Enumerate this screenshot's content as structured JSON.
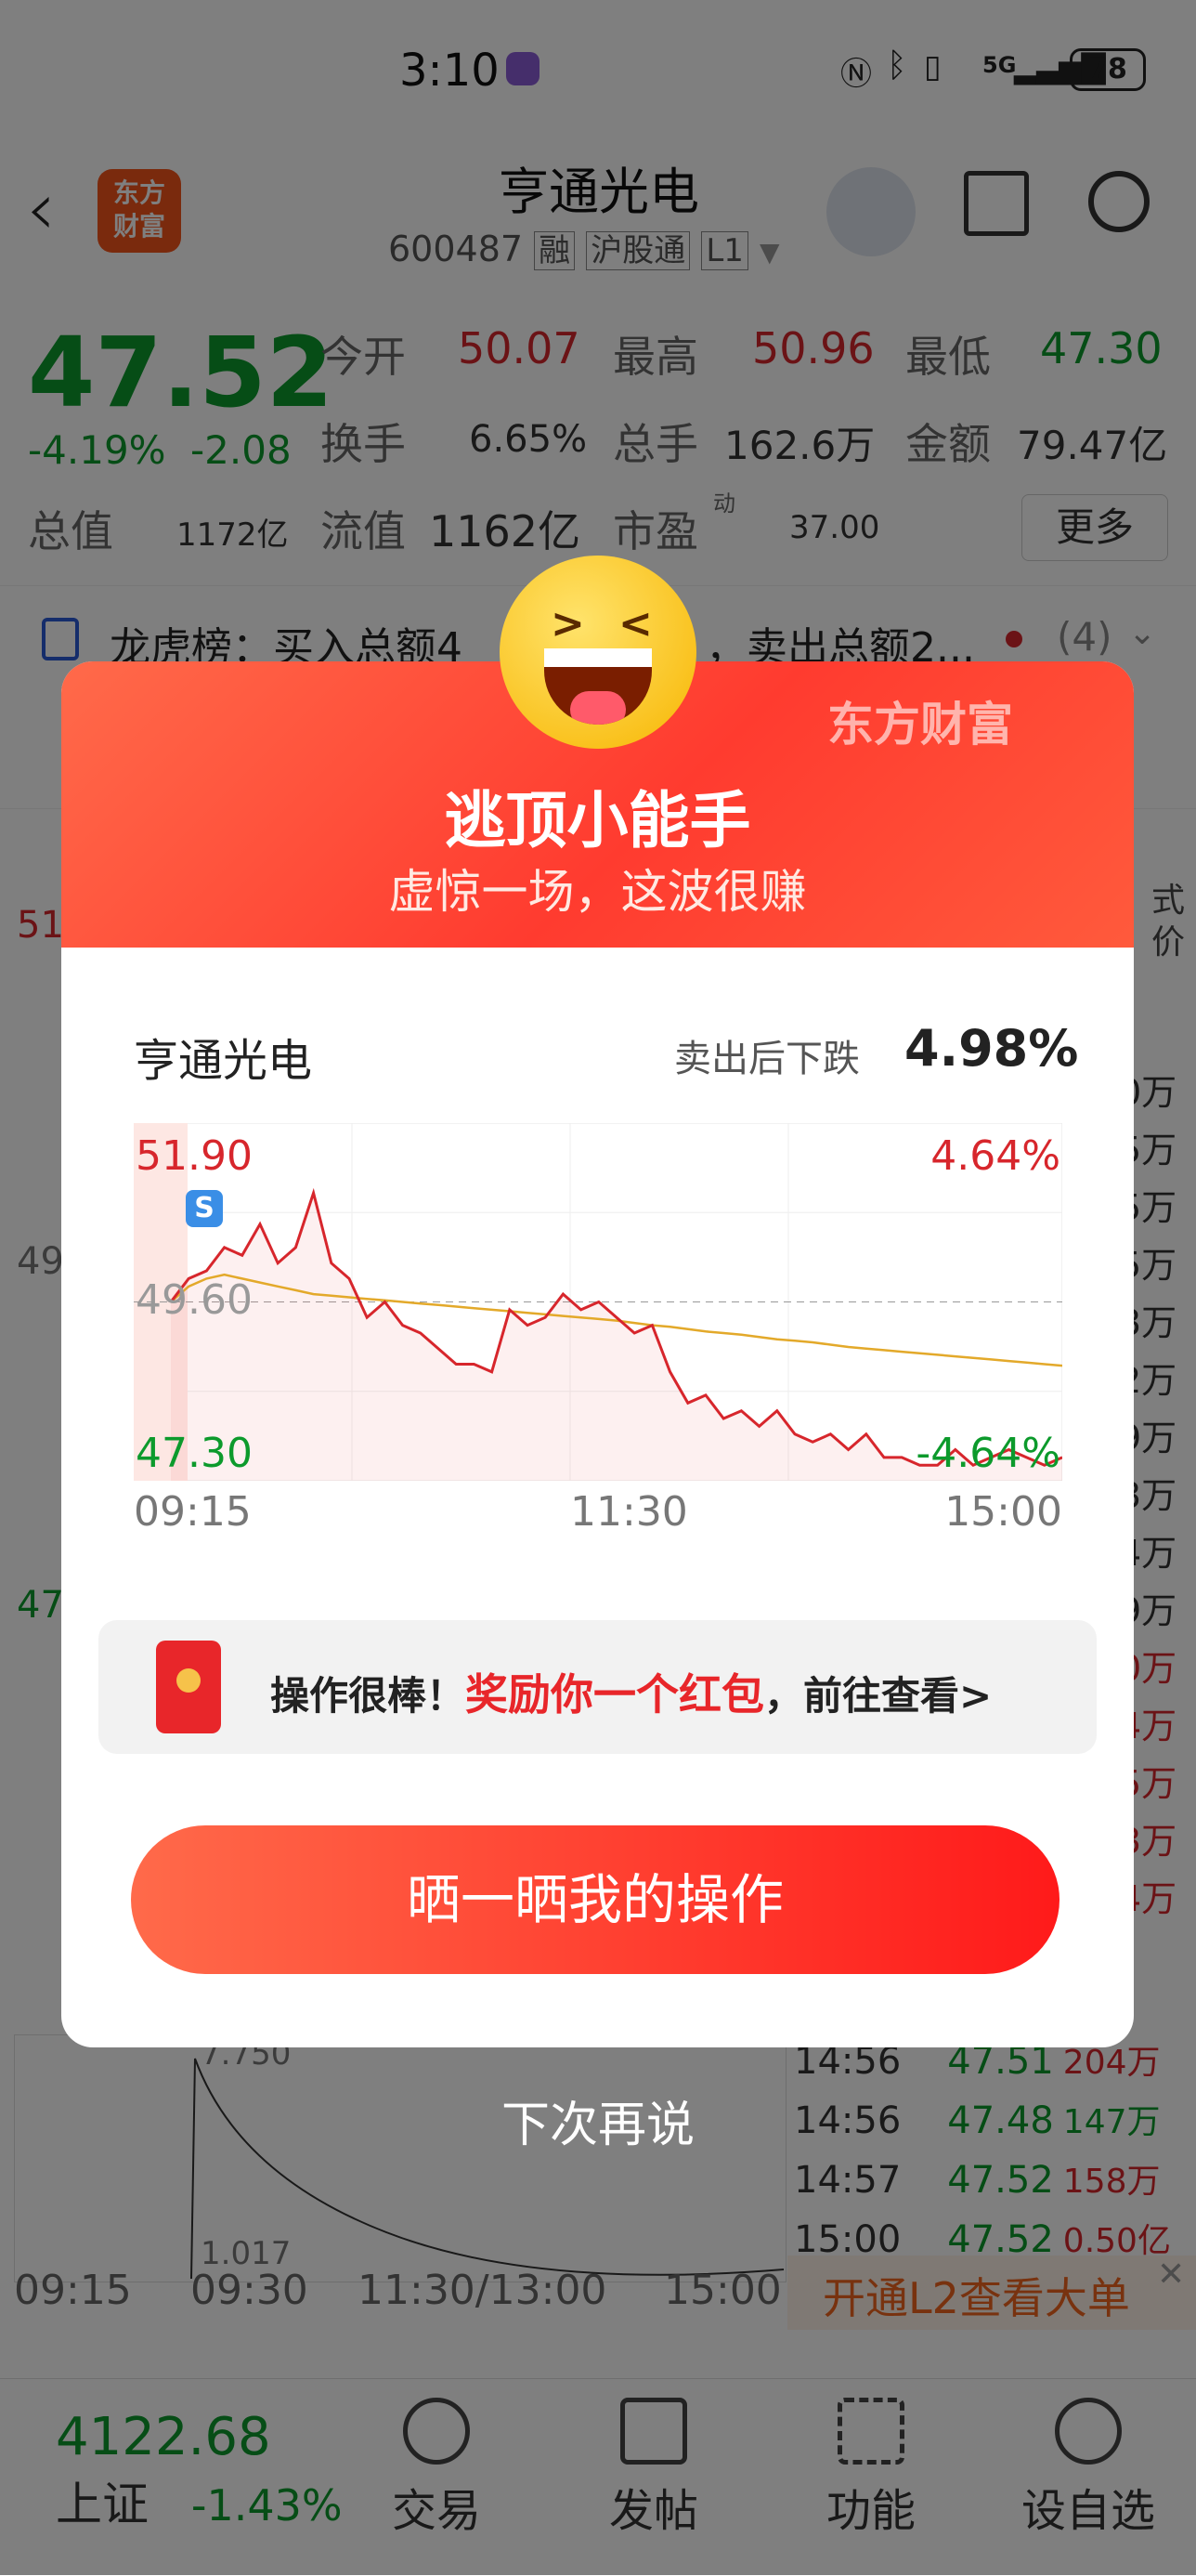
{
  "status_bar": {
    "time": "3:10",
    "battery": "78",
    "network": "5G"
  },
  "header": {
    "back_label": "<",
    "logo_text_line1": "东方",
    "logo_text_line2": "财富",
    "stock_name": "亨通光电",
    "stock_code": "600487",
    "tags": [
      "融",
      "沪股通",
      "L1"
    ]
  },
  "quote": {
    "price": "47.52",
    "change_pct": "-4.19%",
    "change_val": "-2.08",
    "open_label": "今开",
    "open_val": "50.07",
    "high_label": "最高",
    "high_val": "50.96",
    "low_label": "最低",
    "low_val": "47.30",
    "turnover_label": "换手",
    "turnover_val": "6.65%",
    "volume_label": "总手",
    "volume_val": "162.6万",
    "amount_label": "金额",
    "amount_val": "79.47亿",
    "mcap_label": "总值",
    "mcap_val": "1172亿",
    "float_label": "流值",
    "float_val": "1162亿",
    "pe_label": "市盈",
    "pe_sup": "动",
    "pe_val": "37.00",
    "more_label": "更多"
  },
  "lhb": {
    "text": "龙虎榜：买入总额4",
    "text2": "，卖出总额2...",
    "count": "(4)"
  },
  "background_chart": {
    "left_labels": [
      "51",
      "49",
      "47"
    ],
    "time_axis": [
      "09:15",
      "09:30",
      "11:30/13:00",
      "15:00"
    ],
    "vol_labels": [
      "7.750",
      "1.017"
    ],
    "ticks": [
      {
        "time": "14:56",
        "price": "47.51",
        "vol": "204万"
      },
      {
        "time": "14:56",
        "price": "47.48",
        "vol": "147万"
      },
      {
        "time": "14:57",
        "price": "47.52",
        "vol": "158万"
      },
      {
        "time": "15:00",
        "price": "47.52",
        "vol": "0.50亿"
      }
    ],
    "right_col": [
      "0万",
      "5万",
      "5万",
      "5万",
      "3万",
      "2万",
      "9万",
      "3万",
      "4万",
      "9万",
      "0万",
      "4万",
      "5万",
      "3万",
      "4万"
    ],
    "l2_banner": "开通L2查看大单",
    "mode_label": "式",
    "price_label": "价"
  },
  "bottom_nav": {
    "index_value": "4122.68",
    "index_name": "上证",
    "index_change": "-1.43%",
    "items": [
      "交易",
      "发帖",
      "功能",
      "设自选"
    ]
  },
  "modal": {
    "brand": "东方财富",
    "title": "逃顶小能手",
    "subtitle": "虚惊一场，这波很赚",
    "stock_name": "亨通光电",
    "drop_label": "卖出后下跌",
    "drop_value": "4.98%",
    "reward_prefix": "操作很棒！",
    "reward_highlight": "奖励你一个红包",
    "reward_suffix": "，前往查看>",
    "share_button": "晒一晒我的操作",
    "dismiss": "下次再说",
    "sell_marker": "S"
  },
  "chart_data": {
    "type": "line",
    "title": "",
    "x_ticks": [
      "09:15",
      "11:30",
      "15:00"
    ],
    "y_top": "51.90",
    "y_mid": "49.60",
    "y_bottom": "47.30",
    "pct_top": "4.64%",
    "pct_bottom": "-4.64%",
    "ylim": [
      47.3,
      51.9
    ],
    "series": [
      {
        "name": "",
        "values": [
          49.6,
          49.9,
          50.0,
          50.3,
          50.2,
          50.6,
          50.1,
          50.3,
          51.0,
          50.1,
          49.9,
          49.4,
          49.6,
          49.3,
          49.2,
          49.0,
          48.8,
          48.8,
          48.7,
          49.5,
          49.3,
          49.4,
          49.7,
          49.5,
          49.6,
          49.4,
          49.2,
          49.3,
          48.7,
          48.3,
          48.4,
          48.1,
          48.2,
          48.0,
          48.2,
          47.9,
          47.8,
          47.9,
          47.7,
          47.9,
          47.6,
          47.6,
          47.5,
          47.5,
          47.7,
          47.5,
          47.6,
          47.7,
          47.6,
          47.5,
          47.6
        ]
      },
      {
        "name": "",
        "values": [
          49.6,
          49.8,
          49.9,
          49.95,
          49.9,
          49.85,
          49.8,
          49.75,
          49.7,
          49.68,
          49.66,
          49.64,
          49.62,
          49.6,
          49.58,
          49.56,
          49.54,
          49.52,
          49.5,
          49.48,
          49.46,
          49.44,
          49.42,
          49.4,
          49.38,
          49.36,
          49.33,
          49.3,
          49.28,
          49.25,
          49.22,
          49.2,
          49.18,
          49.15,
          49.12,
          49.1,
          49.08,
          49.05,
          49.02,
          49.0,
          48.98,
          48.96,
          48.94,
          48.92,
          48.9,
          48.88,
          48.86,
          48.84,
          48.82,
          48.8,
          48.78
        ]
      }
    ]
  }
}
